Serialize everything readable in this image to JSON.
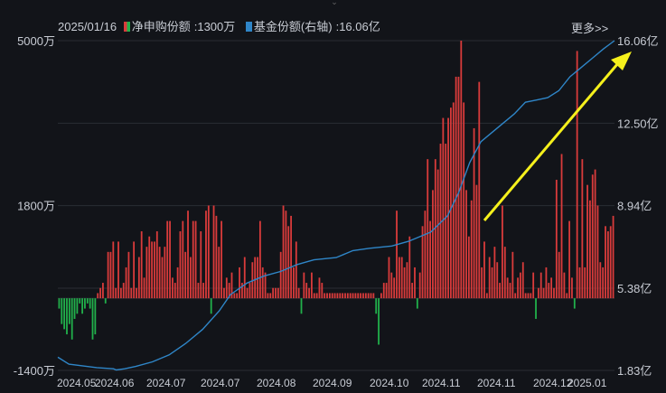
{
  "header": {
    "date": "2025/01/16",
    "series1_label": "净申购份额",
    "series1_value": "1300万",
    "series2_label": "基金份额(右轴)",
    "series2_value": "16.06亿",
    "more": "更多>>",
    "top_handle": "⌄"
  },
  "colors": {
    "up": "#d93b3b",
    "down": "#21b04b",
    "line": "#2f86c8",
    "arrow": "#f5f01c",
    "grid": "#2a2d34"
  },
  "chart_data": {
    "type": "bar+line",
    "left_axis": {
      "ticks": [
        "5000万",
        "1800万",
        "-1400万"
      ],
      "values": [
        5000,
        1800,
        -1400
      ],
      "unit": "万"
    },
    "right_axis": {
      "ticks": [
        "16.06亿",
        "12.50亿",
        "8.94亿",
        "5.38亿",
        "1.83亿"
      ],
      "values": [
        16.06,
        12.5,
        8.94,
        5.38,
        1.83
      ],
      "unit": "亿"
    },
    "x_labels": [
      "2024.05",
      "2024.06",
      "2024.07",
      "2024.07",
      "2024.08",
      "2024.09",
      "2024.10",
      "2024.11",
      "2024.11",
      "2024.12",
      "2025.01"
    ],
    "bars": [
      -200,
      -500,
      -600,
      -700,
      -500,
      -800,
      -400,
      -300,
      -100,
      -300,
      -200,
      -100,
      -200,
      -800,
      -700,
      100,
      200,
      300,
      -100,
      900,
      900,
      1100,
      200,
      1100,
      200,
      300,
      600,
      900,
      200,
      1100,
      200,
      800,
      1300,
      400,
      1000,
      1200,
      1100,
      1100,
      1300,
      1000,
      800,
      1000,
      1500,
      1500,
      400,
      300,
      600,
      1300,
      1500,
      900,
      1700,
      800,
      1500,
      1500,
      300,
      1300,
      300,
      1700,
      1800,
      -300,
      1800,
      1600,
      1000,
      1500,
      200,
      400,
      300,
      500,
      100,
      100,
      600,
      300,
      800,
      200,
      300,
      700,
      800,
      800,
      1500,
      600,
      500,
      100,
      100,
      200,
      200,
      200,
      900,
      1800,
      1700,
      1400,
      1600,
      600,
      1100,
      200,
      -300,
      500,
      300,
      200,
      500,
      100,
      100,
      400,
      300,
      100,
      100,
      100,
      100,
      100,
      100,
      100,
      100,
      100,
      100,
      100,
      100,
      100,
      100,
      100,
      100,
      100,
      100,
      100,
      100,
      -300,
      -900,
      100,
      300,
      300,
      800,
      500,
      400,
      1700,
      800,
      800,
      600,
      700,
      1200,
      300,
      600,
      -200,
      500,
      1400,
      1700,
      2700,
      1500,
      2100,
      2700,
      2500,
      3000,
      3500,
      3000,
      3500,
      3700,
      3800,
      4300,
      4300,
      5000,
      3800,
      2100,
      1200,
      1900,
      3300,
      2200,
      4200,
      600,
      1100,
      100,
      800,
      600,
      1000,
      700,
      300,
      1800,
      1000,
      400,
      300,
      900,
      100,
      400,
      500,
      700,
      100,
      100,
      100,
      500,
      -400,
      200,
      500,
      200,
      600,
      300,
      400,
      200,
      2300,
      900,
      2800,
      500,
      100,
      1500,
      400,
      -200,
      4800,
      600,
      2700,
      600,
      2200,
      1900,
      2400,
      2500,
      1800,
      700,
      600,
      1400,
      1300,
      1400,
      1600
    ]
  },
  "annotation": "trend-arrow"
}
